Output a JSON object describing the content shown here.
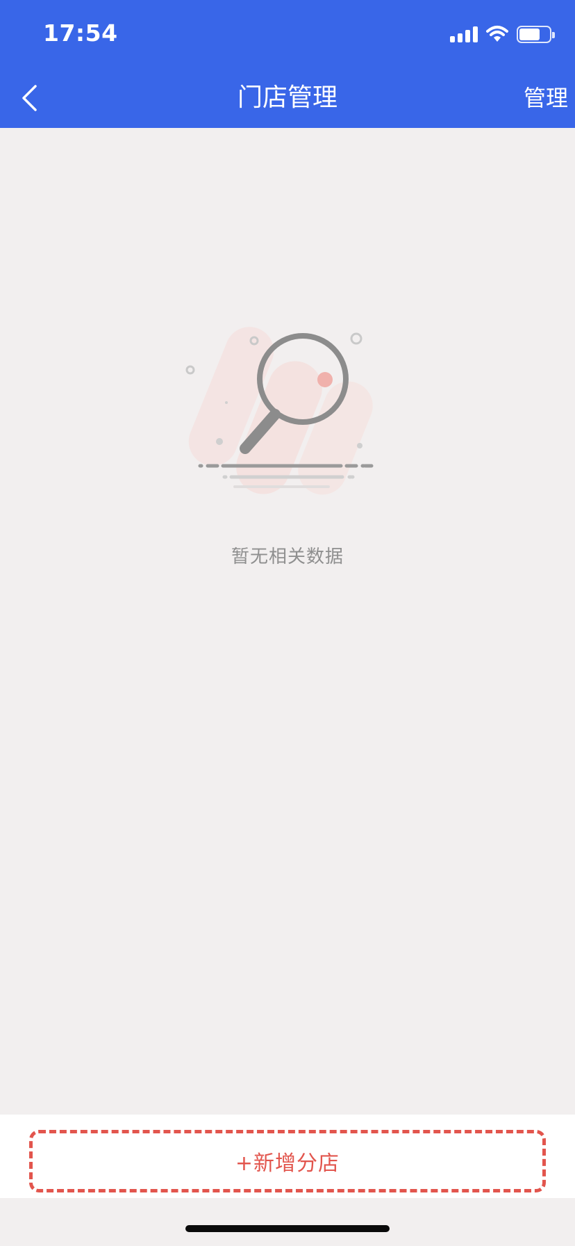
{
  "status_bar": {
    "time": "17:54"
  },
  "nav": {
    "title": "门店管理",
    "right_action": "管理"
  },
  "empty_state": {
    "message": "暂无相关数据"
  },
  "bottom": {
    "add_store_label": "+新增分店"
  },
  "colors": {
    "header_bg": "#3966e8",
    "page_bg": "#f2efef",
    "accent_red": "#e2554d"
  },
  "icons": {
    "back": "chevron-left-icon",
    "empty": "magnifier-empty-illustration"
  }
}
